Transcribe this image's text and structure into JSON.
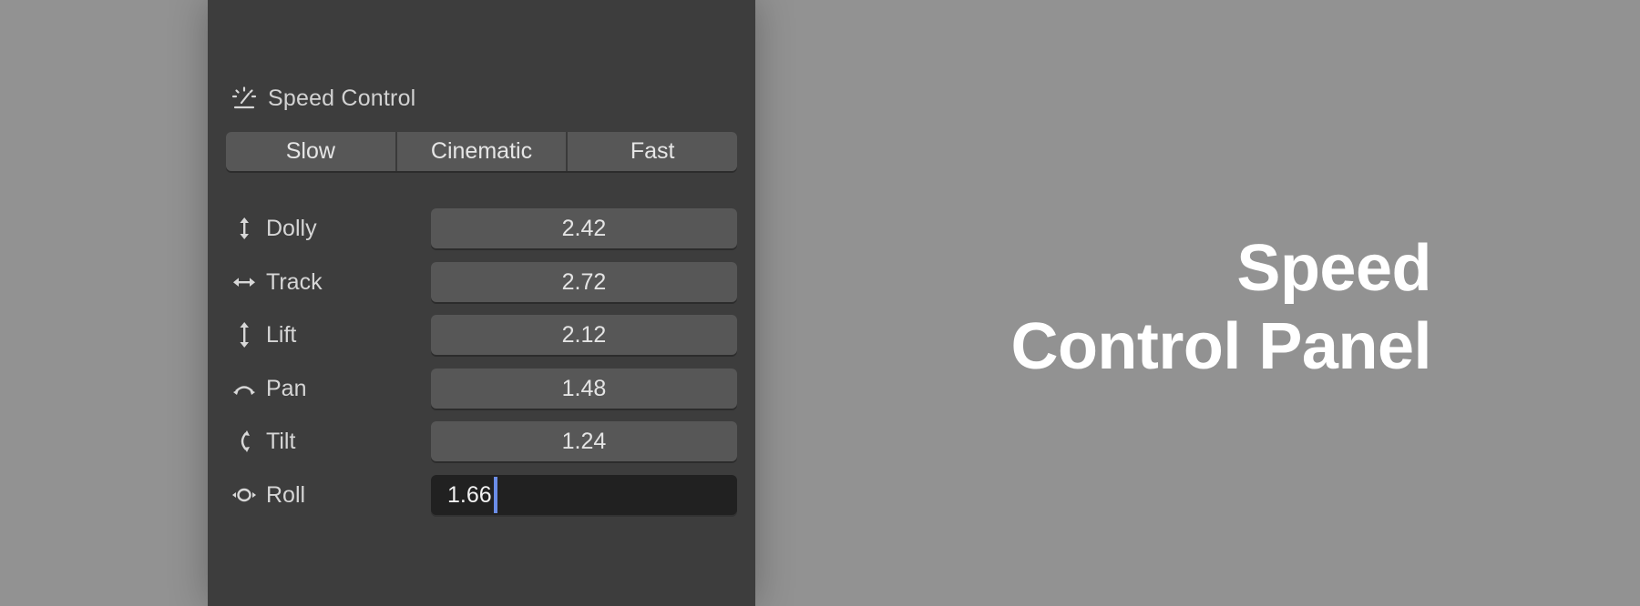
{
  "panel": {
    "title": "Speed Control",
    "title_icon": "speed-gauge-icon",
    "presets": [
      {
        "label": "Slow"
      },
      {
        "label": "Cinematic"
      },
      {
        "label": "Fast"
      }
    ],
    "properties": [
      {
        "label": "Dolly",
        "value": "2.42",
        "icon": "dolly-arrows-icon"
      },
      {
        "label": "Track",
        "value": "2.72",
        "icon": "track-arrows-icon"
      },
      {
        "label": "Lift",
        "value": "2.12",
        "icon": "lift-arrows-icon"
      },
      {
        "label": "Pan",
        "value": "1.48",
        "icon": "pan-arc-icon"
      },
      {
        "label": "Tilt",
        "value": "1.24",
        "icon": "tilt-arc-icon"
      },
      {
        "label": "Roll",
        "value": "1.66",
        "icon": "roll-orbit-icon",
        "editing": true
      }
    ]
  },
  "caption": {
    "line1": "Speed",
    "line2": "Control Panel"
  },
  "colors": {
    "background": "#929292",
    "panel": "#3d3d3d",
    "field": "#575757",
    "field_editing": "#212121",
    "caret": "#6b8de8",
    "caption_text": "#ffffff"
  }
}
